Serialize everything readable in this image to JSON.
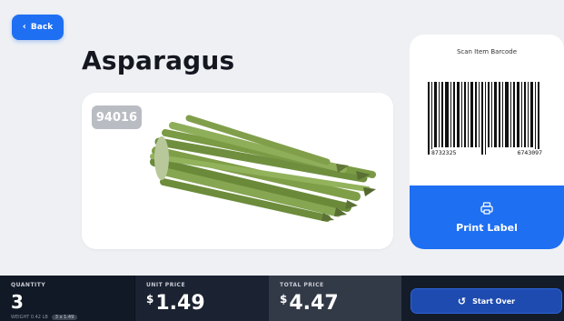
{
  "back": {
    "label": "Back"
  },
  "product": {
    "name": "Asparagus",
    "plu": "94016"
  },
  "scan": {
    "label": "Scan Item Barcode",
    "barcode_left": "8732325",
    "barcode_right": "6743097"
  },
  "print": {
    "label": "Print Label"
  },
  "summary": {
    "quantity_label": "QUANTITY",
    "quantity_value": "3",
    "quantity_sub": "WEIGHT 0.42 LB",
    "quantity_chip": "3 x 1.49",
    "unit_price_label": "UNIT PRICE",
    "unit_price_currency": "$",
    "unit_price_value": "1.49",
    "total_price_label": "TOTAL PRICE",
    "total_price_currency": "$",
    "total_price_value": "4.47"
  },
  "start_over": {
    "label": "Start Over"
  },
  "colors": {
    "accent": "#1e6ff2",
    "bar": "#141b29"
  }
}
